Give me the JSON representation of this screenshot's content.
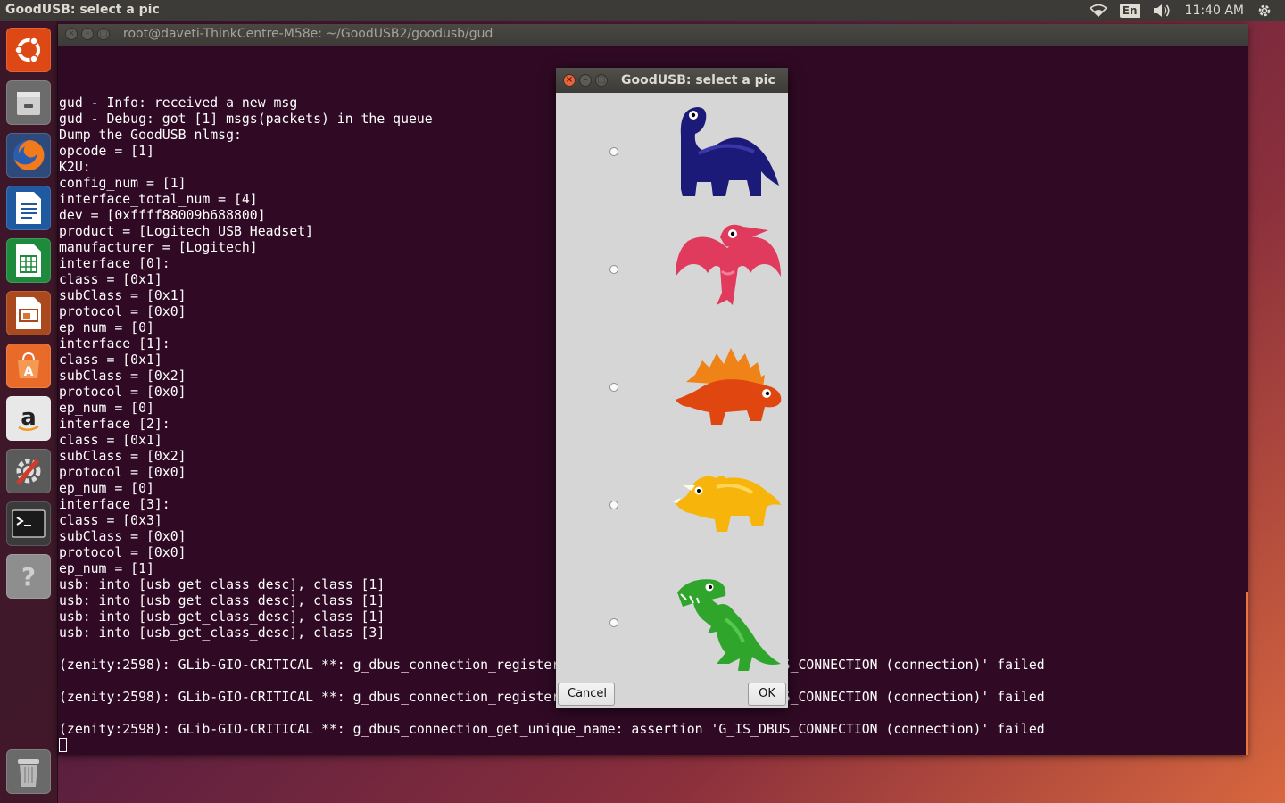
{
  "top_panel": {
    "title": "GoodUSB: select a pic",
    "language": "En",
    "clock": "11:40 AM"
  },
  "launcher": {
    "items": [
      {
        "name": "Ubuntu Dash",
        "icon": "ubuntu-logo-icon"
      },
      {
        "name": "Files",
        "icon": "file-cabinet-icon"
      },
      {
        "name": "Firefox",
        "icon": "firefox-icon"
      },
      {
        "name": "LibreOffice Writer",
        "icon": "writer-icon"
      },
      {
        "name": "LibreOffice Calc",
        "icon": "calc-icon"
      },
      {
        "name": "LibreOffice Impress",
        "icon": "impress-icon"
      },
      {
        "name": "Ubuntu Software Center",
        "icon": "software-center-icon"
      },
      {
        "name": "Amazon",
        "icon": "amazon-icon"
      },
      {
        "name": "System Settings",
        "icon": "settings-icon"
      },
      {
        "name": "Terminal",
        "icon": "terminal-icon"
      },
      {
        "name": "Help",
        "icon": "help-icon"
      },
      {
        "name": "Trash",
        "icon": "trash-icon"
      }
    ]
  },
  "terminal": {
    "title": "root@daveti-ThinkCentre-M58e: ~/GoodUSB2/goodusb/gud",
    "lines": [
      "gud - Info: received a new msg",
      "gud - Debug: got [1] msgs(packets) in the queue",
      "Dump the GoodUSB nlmsg:",
      "opcode = [1]",
      "K2U:",
      "config_num = [1]",
      "interface_total_num = [4]",
      "dev = [0xffff88009b688800]",
      "product = [Logitech USB Headset]",
      "manufacturer = [Logitech]",
      "interface [0]:",
      "class = [0x1]",
      "subClass = [0x1]",
      "protocol = [0x0]",
      "ep_num = [0]",
      "interface [1]:",
      "class = [0x1]",
      "subClass = [0x2]",
      "protocol = [0x0]",
      "ep_num = [0]",
      "interface [2]:",
      "class = [0x1]",
      "subClass = [0x2]",
      "protocol = [0x0]",
      "ep_num = [0]",
      "interface [3]:",
      "class = [0x3]",
      "subClass = [0x0]",
      "protocol = [0x0]",
      "ep_num = [1]",
      "usb: into [usb_get_class_desc], class [1]",
      "usb: into [usb_get_class_desc], class [1]",
      "usb: into [usb_get_class_desc], class [1]",
      "usb: into [usb_get_class_desc], class [3]",
      "",
      "(zenity:2598): GLib-GIO-CRITICAL **: g_dbus_connection_register_object: assertion 'G_IS_DBUS_CONNECTION (connection)' failed",
      "",
      "(zenity:2598): GLib-GIO-CRITICAL **: g_dbus_connection_register_object: assertion 'G_IS_DBUS_CONNECTION (connection)' failed",
      "",
      "(zenity:2598): GLib-GIO-CRITICAL **: g_dbus_connection_get_unique_name: assertion 'G_IS_DBUS_CONNECTION (connection)' failed"
    ]
  },
  "dialog": {
    "title": "GoodUSB: select a pic",
    "options": [
      {
        "name": "blue brontosaurus",
        "color": "#1c1a78"
      },
      {
        "name": "pink pterodactyl",
        "color": "#e03a5c"
      },
      {
        "name": "orange stegosaurus",
        "color": "#e0460f"
      },
      {
        "name": "yellow triceratops",
        "color": "#f7b40a"
      },
      {
        "name": "green t-rex",
        "color": "#2fa52c"
      }
    ],
    "cancel_label": "Cancel",
    "ok_label": "OK"
  },
  "colors": {
    "terminal_bg": "#300a24",
    "panel_bg": "#3c3b37",
    "accent": "#e9643a"
  }
}
